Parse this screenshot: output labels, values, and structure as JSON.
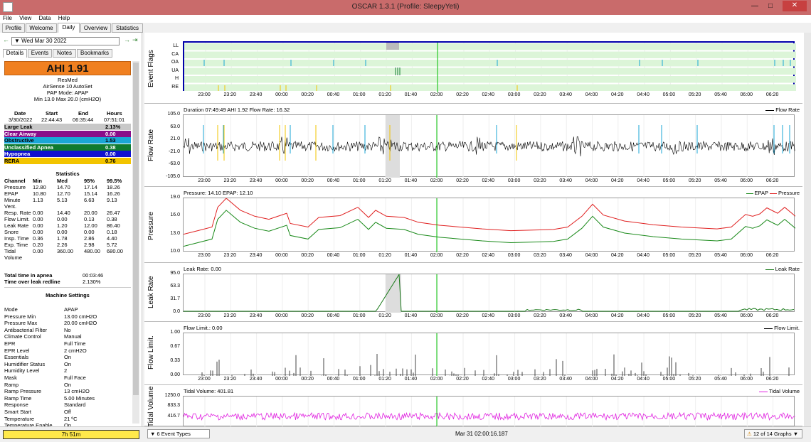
{
  "window": {
    "title": "OSCAR 1.3.1 (Profile: SleepyYeti)"
  },
  "menu": [
    "File",
    "View",
    "Data",
    "Help"
  ],
  "tabs": [
    "Profile",
    "Welcome",
    "Daily",
    "Overview",
    "Statistics"
  ],
  "nav": {
    "date": "Wed Mar 30 2022"
  },
  "subtabs": [
    "Details",
    "Events",
    "Notes",
    "Bookmarks"
  ],
  "ahi": {
    "label": "AHI 1.91"
  },
  "machine": {
    "brand": "ResMed",
    "model": "AirSense 10 AutoSet",
    "mode": "PAP Mode: APAP",
    "pressure": "Min 13.0 Max 20.0 (cmH2O)"
  },
  "session": {
    "headers": [
      "Date",
      "Start",
      "End",
      "Hours"
    ],
    "values": [
      "3/30/2022",
      "22:44:43",
      "06:35:44",
      "07:51:01"
    ]
  },
  "events": [
    {
      "name": "Large Leak",
      "value": "2.13%",
      "color": "#c8c8c8",
      "text": "#000"
    },
    {
      "name": "Clear Airway",
      "value": "0.00",
      "color": "#8a0d8a",
      "text": "#fff"
    },
    {
      "name": "Obstructive",
      "value": "1.53",
      "color": "#1aa6d6",
      "text": "#000"
    },
    {
      "name": "Unclassified Apnea",
      "value": "0.38",
      "color": "#0f7a30",
      "text": "#fff"
    },
    {
      "name": "Hypopnea",
      "value": "0.00",
      "color": "#1010d0",
      "text": "#fff"
    },
    {
      "name": "RERA",
      "value": "0.76",
      "color": "#f2c400",
      "text": "#000"
    }
  ],
  "stats": {
    "title": "Statistics",
    "headers": [
      "Channel",
      "Min",
      "Med",
      "95%",
      "99.5%"
    ],
    "rows": [
      [
        "Pressure",
        "12.80",
        "14.70",
        "17.14",
        "18.26"
      ],
      [
        "EPAP",
        "10.80",
        "12.70",
        "15.14",
        "16.26"
      ],
      [
        "Minute Vent.",
        "1.13",
        "5.13",
        "6.63",
        "9.13"
      ],
      [
        "Resp. Rate",
        "0.00",
        "14.40",
        "20.00",
        "26.47"
      ],
      [
        "Flow Limit.",
        "0.00",
        "0.00",
        "0.13",
        "0.38"
      ],
      [
        "Leak Rate",
        "0.00",
        "1.20",
        "12.00",
        "86.40"
      ],
      [
        "Snore",
        "0.00",
        "0.00",
        "0.00",
        "0.18"
      ],
      [
        "Insp. Time",
        "0.36",
        "1.78",
        "2.86",
        "4.40"
      ],
      [
        "Exp. Time",
        "0.20",
        "2.26",
        "2.98",
        "5.72"
      ],
      [
        "Tidal Volume",
        "0.00",
        "360.00",
        "480.00",
        "680.00"
      ]
    ]
  },
  "totals": [
    {
      "label": "Total time in apnea",
      "value": "00:03:46"
    },
    {
      "label": "Time over leak redline",
      "value": "2.130%"
    }
  ],
  "settings": {
    "title": "Machine Settings",
    "rows": [
      [
        "Mode",
        "APAP"
      ],
      [
        "Pressure Min",
        "13.00 cmH2O"
      ],
      [
        "Pressure Max",
        "20.00 cmH2O"
      ],
      [
        "Antibacterial Filter",
        "No"
      ],
      [
        "Climate Control",
        "Manual"
      ],
      [
        "EPR",
        "Full Time"
      ],
      [
        "EPR Level",
        "2 cmH2O"
      ],
      [
        "Essentials",
        "On"
      ],
      [
        "Humidifier Status",
        "On"
      ],
      [
        "Humidity Level",
        "2"
      ],
      [
        "Mask",
        "Full Face"
      ],
      [
        "Ramp",
        "On"
      ],
      [
        "Ramp Pressure",
        "13 cmH2O"
      ],
      [
        "Ramp Time",
        "5.00 Minutes"
      ],
      [
        "Response",
        "Standard"
      ],
      [
        "Smart Start",
        "Off"
      ],
      [
        "Temperature",
        "21 ºC"
      ],
      [
        "Temperature Enable",
        "On"
      ]
    ]
  },
  "bottom": {
    "duration": "7h 51m",
    "event_types": "6 Event Types",
    "cursor_time": "Mar 31 02:00:16.187",
    "graphs": "12 of 14 Graphs"
  },
  "xticks": [
    "23:00",
    "23:20",
    "23:40",
    "00:00",
    "00:20",
    "00:40",
    "01:00",
    "01:20",
    "01:40",
    "02:00",
    "02:20",
    "02:40",
    "03:00",
    "03:20",
    "03:40",
    "04:00",
    "04:20",
    "04:40",
    "05:00",
    "05:20",
    "05:40",
    "06:00",
    "06:20"
  ],
  "panels": {
    "flags": {
      "label": "Event Flags",
      "rows": [
        "LL",
        "CA",
        "OA",
        "UA",
        "H",
        "RE"
      ]
    },
    "flow": {
      "label": "Flow Rate",
      "title": "Duration 07:49:49 AHI 1.92 Flow Rate: 16.32",
      "legend": "Flow Rate",
      "yticks": [
        "105.0",
        "63.0",
        "21.0",
        "-21.0",
        "-63.0",
        "-105.0"
      ]
    },
    "pressure": {
      "label": "Pressure",
      "title": "Pressure: 14.10 EPAP: 12.10",
      "legend1": "EPAP",
      "legend2": "Pressure",
      "yticks": [
        "19.0",
        "16.0",
        "13.0",
        "10.0"
      ]
    },
    "leak": {
      "label": "Leak Rate",
      "title": "Leak Rate: 0.00",
      "legend": "Leak Rate",
      "yticks": [
        "95.0",
        "63.3",
        "31.7",
        "0.0"
      ]
    },
    "flowlim": {
      "label": "Flow Limit.",
      "title": "Flow Limit.: 0.00",
      "legend": "Flow Limit.",
      "yticks": [
        "1.00",
        "0.67",
        "0.33",
        "0.00"
      ]
    },
    "tidal": {
      "label": "Tidal Volume",
      "title": "Tidal Volume: 401.81",
      "legend": "Tidal Volume",
      "yticks": [
        "1250.0",
        "833.3",
        "416.7"
      ]
    }
  },
  "colors": {
    "pressure": "#e02020",
    "epap": "#1a8a1a",
    "leak": "#1a7a1a",
    "tidal": "#e020e0",
    "flagbg": "#dcf5d8",
    "cursor": "#00c000"
  }
}
